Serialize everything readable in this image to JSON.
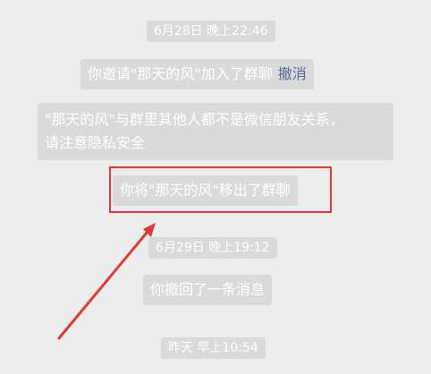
{
  "chat": {
    "timestamp_1": "6月28日 晚上22:46",
    "invite_text": "你邀请\"那天的风\"加入了群聊",
    "revoke_link": "撤消",
    "warning_line_1": "\"那天的风\"与群里其他人都不是微信朋友关系，",
    "warning_line_2": "请注意隐私安全",
    "removed_text": "你将\"那天的风\"移出了群聊",
    "timestamp_2": "6月29日 晚上19:12",
    "recall_text": "你撤回了一条消息",
    "timestamp_3": "昨天 早上10:54"
  },
  "annotation": {
    "color": "#e53935"
  }
}
